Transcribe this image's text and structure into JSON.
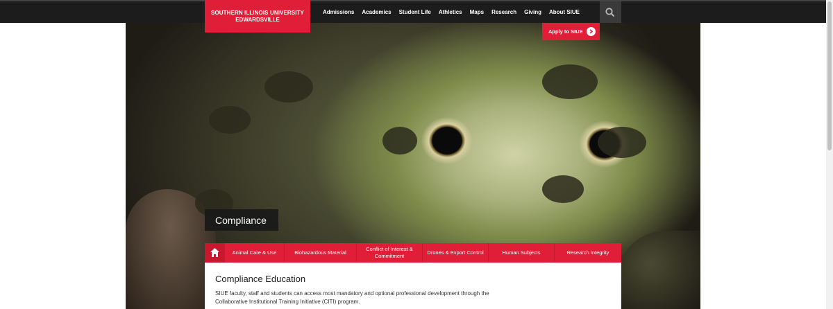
{
  "header": {
    "logo_line1": "SOUTHERN ILLINOIS UNIVERSITY",
    "logo_line2": "EDWARDSVILLE",
    "nav": [
      "Admissions",
      "Academics",
      "Student Life",
      "Athletics",
      "Maps",
      "Research",
      "Giving",
      "About SIUE"
    ],
    "apply_label": "Apply to SIUE"
  },
  "hero": {
    "page_title": "Compliance"
  },
  "subnav": {
    "items": [
      "Animal Care & Use",
      "Biohazardous Material",
      "Conflict of Interest & Commitment",
      "Drones & Export Control",
      "Human Subjects",
      "Research Integrity"
    ]
  },
  "main": {
    "heading": "Compliance Education",
    "body": "SIUE faculty, staff and students can access most mandatory and optional professional development through the Collaborative Institutional Training Initiative (CITI) program."
  },
  "colors": {
    "accent": "#e01e37",
    "topbar": "#1c1c1c"
  }
}
